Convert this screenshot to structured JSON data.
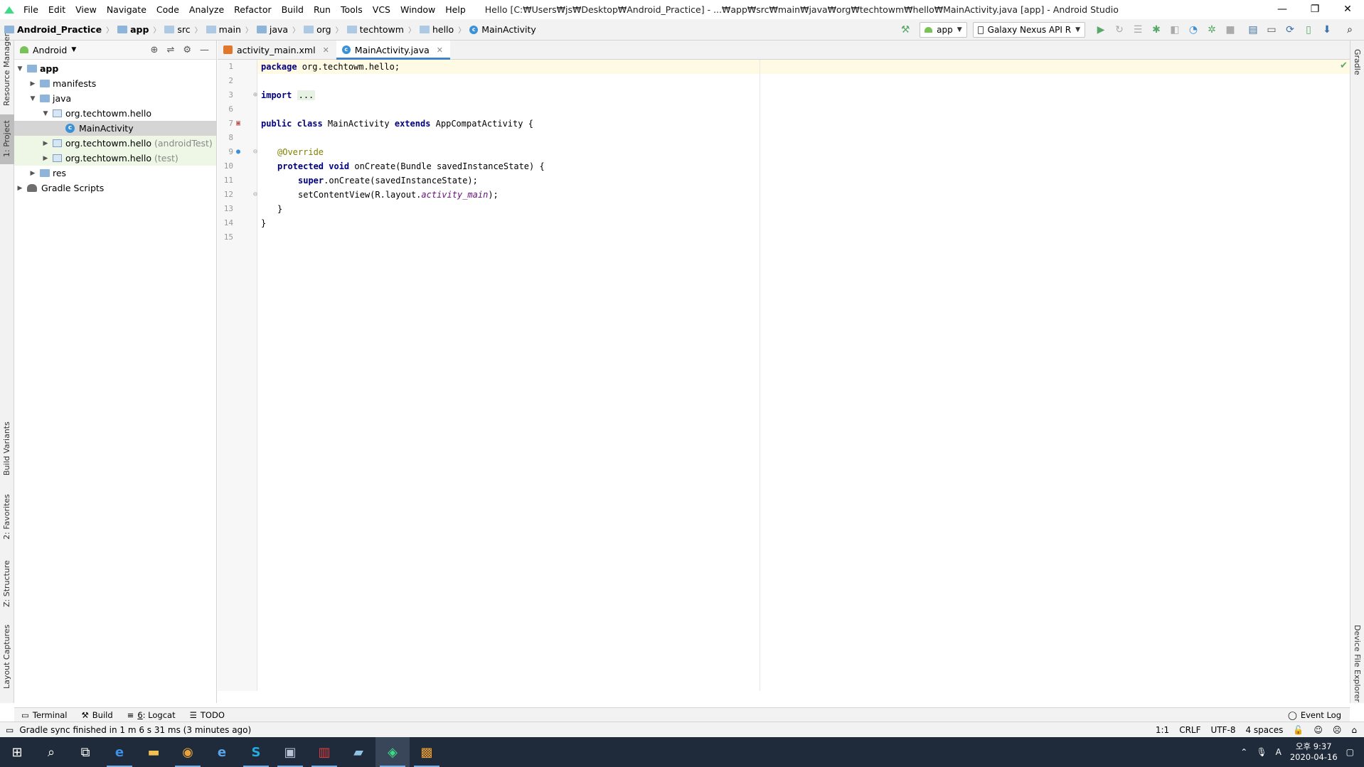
{
  "menubar": {
    "items": [
      "File",
      "Edit",
      "View",
      "Navigate",
      "Code",
      "Analyze",
      "Refactor",
      "Build",
      "Run",
      "Tools",
      "VCS",
      "Window",
      "Help"
    ],
    "window_title": "Hello [C:₩Users₩js₩Desktop₩Android_Practice] - ...₩app₩src₩main₩java₩org₩techtowm₩hello₩MainActivity.java [app] - Android Studio"
  },
  "breadcrumb": [
    "Android_Practice",
    "app",
    "src",
    "main",
    "java",
    "org",
    "techtowm",
    "hello",
    "MainActivity"
  ],
  "run_config": {
    "module": "app",
    "device": "Galaxy Nexus API R"
  },
  "project_panel": {
    "view": "Android",
    "tree": [
      {
        "label": "app",
        "extra": ""
      },
      {
        "label": "manifests",
        "extra": ""
      },
      {
        "label": "java",
        "extra": ""
      },
      {
        "label": "org.techtowm.hello",
        "extra": ""
      },
      {
        "label": "MainActivity",
        "extra": ""
      },
      {
        "label": "org.techtowm.hello",
        "extra": "(androidTest)"
      },
      {
        "label": "org.techtowm.hello",
        "extra": "(test)"
      },
      {
        "label": "res",
        "extra": ""
      },
      {
        "label": "Gradle Scripts",
        "extra": ""
      }
    ]
  },
  "left_tabs": [
    "Resource Manager",
    "1: Project",
    "Build Variants",
    "2: Favorites",
    "Z: Structure",
    "Layout Captures"
  ],
  "right_tabs": [
    "Gradle",
    "Device File Explorer"
  ],
  "editor": {
    "tabs": [
      {
        "label": "activity_main.xml"
      },
      {
        "label": "MainActivity.java"
      }
    ],
    "line_numbers": [
      "1",
      "2",
      "3",
      "6",
      "7",
      "8",
      "9",
      "10",
      "11",
      "12",
      "13",
      "14",
      "15"
    ],
    "code": {
      "l1_kw": "package",
      "l1_rest": " org.techtowm.hello;",
      "l3_kw": "import",
      "l3_fold": "...",
      "l7_kw1": "public class",
      "l7_name": " MainActivity ",
      "l7_kw2": "extends",
      "l7_rest": " AppCompatActivity {",
      "l9_ann": "@Override",
      "l10_kw": "protected void",
      "l10_rest": " onCreate(Bundle savedInstanceState) {",
      "l11_kw": "super",
      "l11_rest": ".onCreate(savedInstanceState);",
      "l12_pre": "setContentView(R.layout.",
      "l12_it": "activity_main",
      "l12_post": ");",
      "l13": "}",
      "l14": "}"
    }
  },
  "bottom_tools": {
    "terminal": "Terminal",
    "build": "Build",
    "logcat_num": "6",
    "logcat": ": Logcat",
    "todo": "TODO",
    "event_log": "Event Log"
  },
  "status": {
    "message": "Gradle sync finished in 1 m 6 s 31 ms (3 minutes ago)",
    "position": "1:1",
    "line_sep": "CRLF",
    "encoding": "UTF-8",
    "indent": "4 spaces"
  },
  "taskbar": {
    "ime": "A",
    "time": "오후 9:37",
    "date": "2020-04-16"
  }
}
